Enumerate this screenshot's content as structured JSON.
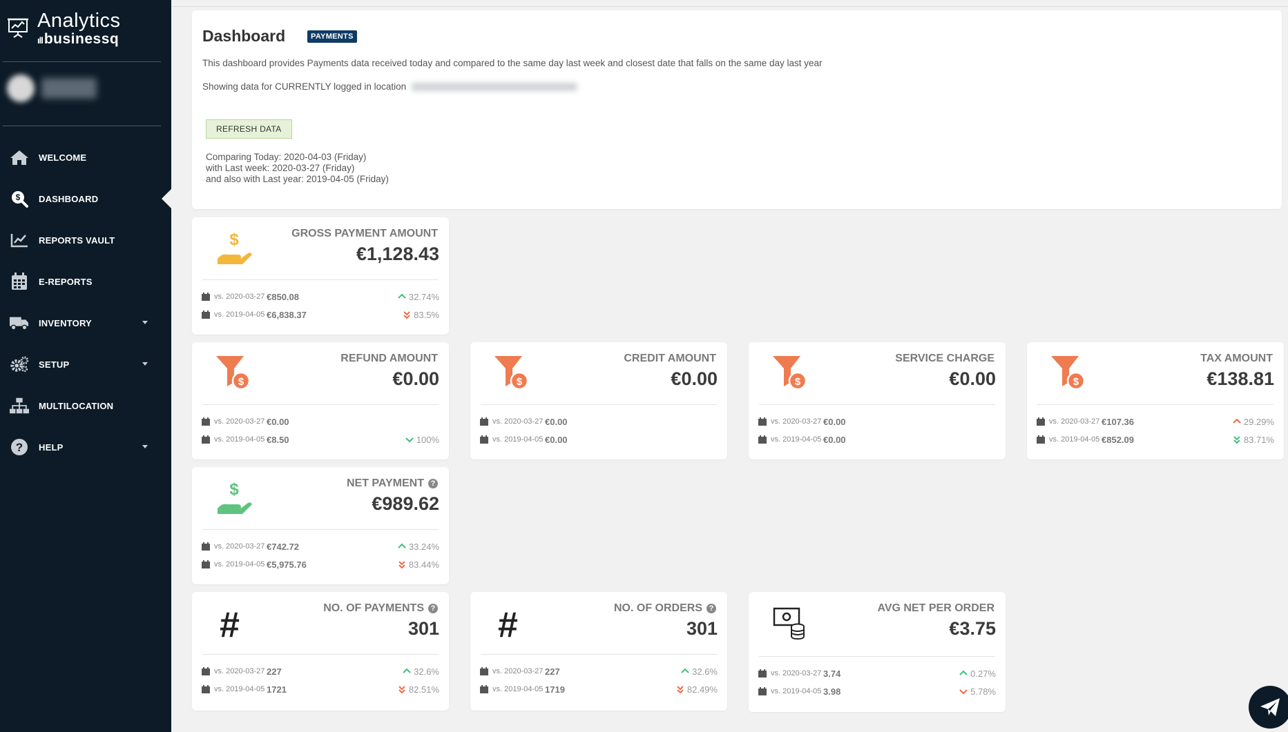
{
  "brand": {
    "title": "Analytics",
    "sub": "businessq",
    "bars": "ıll"
  },
  "nav": [
    {
      "label": "WELCOME",
      "icon": "home-icon"
    },
    {
      "label": "DASHBOARD",
      "icon": "search-dollar-icon"
    },
    {
      "label": "REPORTS VAULT",
      "icon": "chart-line-icon"
    },
    {
      "label": "E-REPORTS",
      "icon": "calendar-icon"
    },
    {
      "label": "INVENTORY",
      "icon": "truck-icon"
    },
    {
      "label": "SETUP",
      "icon": "gears-icon"
    },
    {
      "label": "MULTILOCATION",
      "icon": "sitemap-icon"
    },
    {
      "label": "HELP",
      "icon": "question-circle-icon"
    }
  ],
  "dashboard": {
    "title": "Dashboard",
    "badge": "PAYMENTS",
    "description": "This dashboard provides Payments data received today and compared to the same day last week and closest date that falls on the same day last year",
    "location_label": "Showing data for CURRENTLY logged in location",
    "refresh_label": "REFRESH DATA",
    "compare_today": "Comparing Today: 2020-04-03 (Friday)",
    "compare_week": "with Last week: 2020-03-27 (Friday)",
    "compare_year": "and also with Last year: 2019-04-05 (Friday)"
  },
  "colors": {
    "sidebar": "#0c1b27",
    "up": "#3dbf7b",
    "down": "#ee6a45",
    "gold": "#f3b73b",
    "orange": "#ef7b50",
    "green": "#5ec37f"
  },
  "cards": [
    {
      "title": "GROSS PAYMENT AMOUNT",
      "value": "€1,128.43",
      "icon": "hand-dollar-icon",
      "rows": [
        {
          "vs": "vs. 2020-03-27",
          "amt": "€850.08",
          "pct": "32.74%",
          "dir": "up"
        },
        {
          "vs": "vs. 2019-04-05",
          "amt": "€6,838.37",
          "pct": "83.5%",
          "dir": "down-double"
        }
      ]
    },
    {
      "title": "REFUND AMOUNT",
      "value": "€0.00",
      "icon": "funnel-dollar-icon",
      "rows": [
        {
          "vs": "vs. 2020-03-27",
          "amt": "€0.00",
          "pct": "",
          "dir": ""
        },
        {
          "vs": "vs. 2019-04-05",
          "amt": "€8.50",
          "pct": "100%",
          "dir": "down-good"
        }
      ]
    },
    {
      "title": "CREDIT AMOUNT",
      "value": "€0.00",
      "icon": "funnel-dollar-icon",
      "rows": [
        {
          "vs": "vs. 2020-03-27",
          "amt": "€0.00",
          "pct": "",
          "dir": ""
        },
        {
          "vs": "vs. 2019-04-05",
          "amt": "€0.00",
          "pct": "",
          "dir": ""
        }
      ]
    },
    {
      "title": "SERVICE CHARGE",
      "value": "€0.00",
      "icon": "funnel-dollar-icon",
      "rows": [
        {
          "vs": "vs. 2020-03-27",
          "amt": "€0.00",
          "pct": "",
          "dir": ""
        },
        {
          "vs": "vs. 2019-04-05",
          "amt": "€0.00",
          "pct": "",
          "dir": ""
        }
      ]
    },
    {
      "title": "TAX AMOUNT",
      "value": "€138.81",
      "icon": "funnel-dollar-icon",
      "rows": [
        {
          "vs": "vs. 2020-03-27",
          "amt": "€107.36",
          "pct": "29.29%",
          "dir": "up-bad"
        },
        {
          "vs": "vs. 2019-04-05",
          "amt": "€852.09",
          "pct": "83.71%",
          "dir": "down-double-good"
        }
      ]
    },
    {
      "title": "NET PAYMENT",
      "value": "€989.62",
      "icon": "hand-dollar-icon",
      "rows": [
        {
          "vs": "vs. 2020-03-27",
          "amt": "€742.72",
          "pct": "33.24%",
          "dir": "up"
        },
        {
          "vs": "vs. 2019-04-05",
          "amt": "€5,975.76",
          "pct": "83.44%",
          "dir": "down-double"
        }
      ]
    },
    {
      "title": "NO. OF PAYMENTS",
      "value": "301",
      "icon": "hash-icon",
      "rows": [
        {
          "vs": "vs. 2020-03-27",
          "amt": "227",
          "pct": "32.6%",
          "dir": "up"
        },
        {
          "vs": "vs. 2019-04-05",
          "amt": "1721",
          "pct": "82.51%",
          "dir": "down-double"
        }
      ]
    },
    {
      "title": "NO. OF ORDERS",
      "value": "301",
      "icon": "hash-icon",
      "rows": [
        {
          "vs": "vs. 2020-03-27",
          "amt": "227",
          "pct": "32.6%",
          "dir": "up"
        },
        {
          "vs": "vs. 2019-04-05",
          "amt": "1719",
          "pct": "82.49%",
          "dir": "down-double"
        }
      ]
    },
    {
      "title": "AVG NET PER ORDER",
      "value": "€3.75",
      "icon": "money-coins-icon",
      "rows": [
        {
          "vs": "vs. 2020-03-27",
          "amt": "3.74",
          "pct": "0.27%",
          "dir": "up"
        },
        {
          "vs": "vs. 2019-04-05",
          "amt": "3.98",
          "pct": "5.78%",
          "dir": "down"
        }
      ]
    }
  ]
}
